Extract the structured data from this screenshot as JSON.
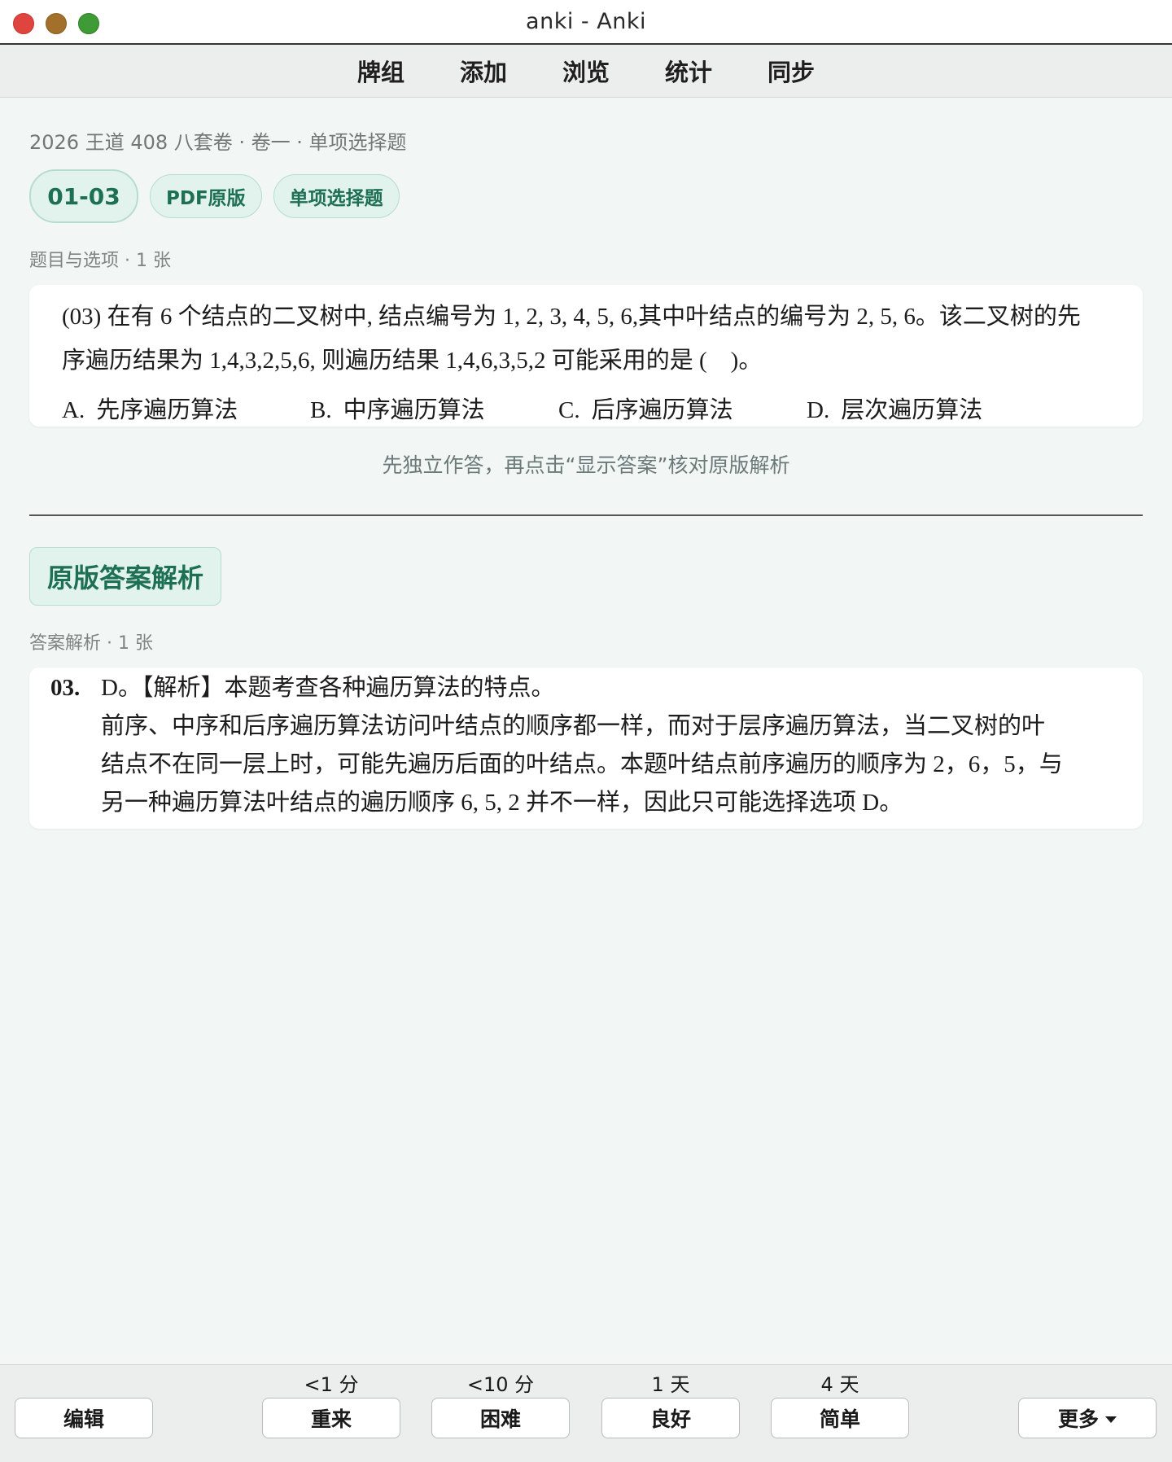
{
  "window": {
    "title": "anki - Anki"
  },
  "topnav": {
    "items": [
      "牌组",
      "添加",
      "浏览",
      "统计",
      "同步"
    ]
  },
  "breadcrumb": "2026 王道 408 八套卷 · 卷一 · 单项选择题",
  "tags": {
    "number": "01-03",
    "source": "PDF原版",
    "type": "单项选择题"
  },
  "question_section_label": "题目与选项 · 1 张",
  "question": {
    "line1": "(03) 在有 6 个结点的二叉树中, 结点编号为 1, 2, 3, 4, 5, 6,其中叶结点的编号为 2, 5, 6。该二叉树的先",
    "line2": "序遍历结果为 1,4,3,2,5,6, 则遍历结果 1,4,6,3,5,2 可能采用的是 ( )。",
    "options": [
      {
        "letter": "A.",
        "text": "先序遍历算法"
      },
      {
        "letter": "B.",
        "text": "中序遍历算法"
      },
      {
        "letter": "C.",
        "text": "后序遍历算法"
      },
      {
        "letter": "D.",
        "text": "层次遍历算法"
      }
    ]
  },
  "hint": "先独立作答，再点击“显示答案”核对原版解析",
  "answer_header": "原版答案解析",
  "answer_section_label": "答案解析 · 1 张",
  "answer": {
    "number": "03.",
    "line1": "D。【解析】本题考查各种遍历算法的特点。",
    "line2": "前序、中序和后序遍历算法访问叶结点的顺序都一样，而对于层序遍历算法，当二叉树的叶",
    "line3": "结点不在同一层上时，可能先遍历后面的叶结点。本题叶结点前序遍历的顺序为 2，6，5，与",
    "line4": "另一种遍历算法叶结点的遍历顺序 6, 5, 2 并不一样，因此只可能选择选项 D。"
  },
  "bottom": {
    "edit": "编辑",
    "more": "更多",
    "answers": [
      {
        "label": "重来",
        "interval": "<1 分"
      },
      {
        "label": "困难",
        "interval": "<10 分"
      },
      {
        "label": "良好",
        "interval": "1 天"
      },
      {
        "label": "简单",
        "interval": "4 天"
      }
    ]
  }
}
